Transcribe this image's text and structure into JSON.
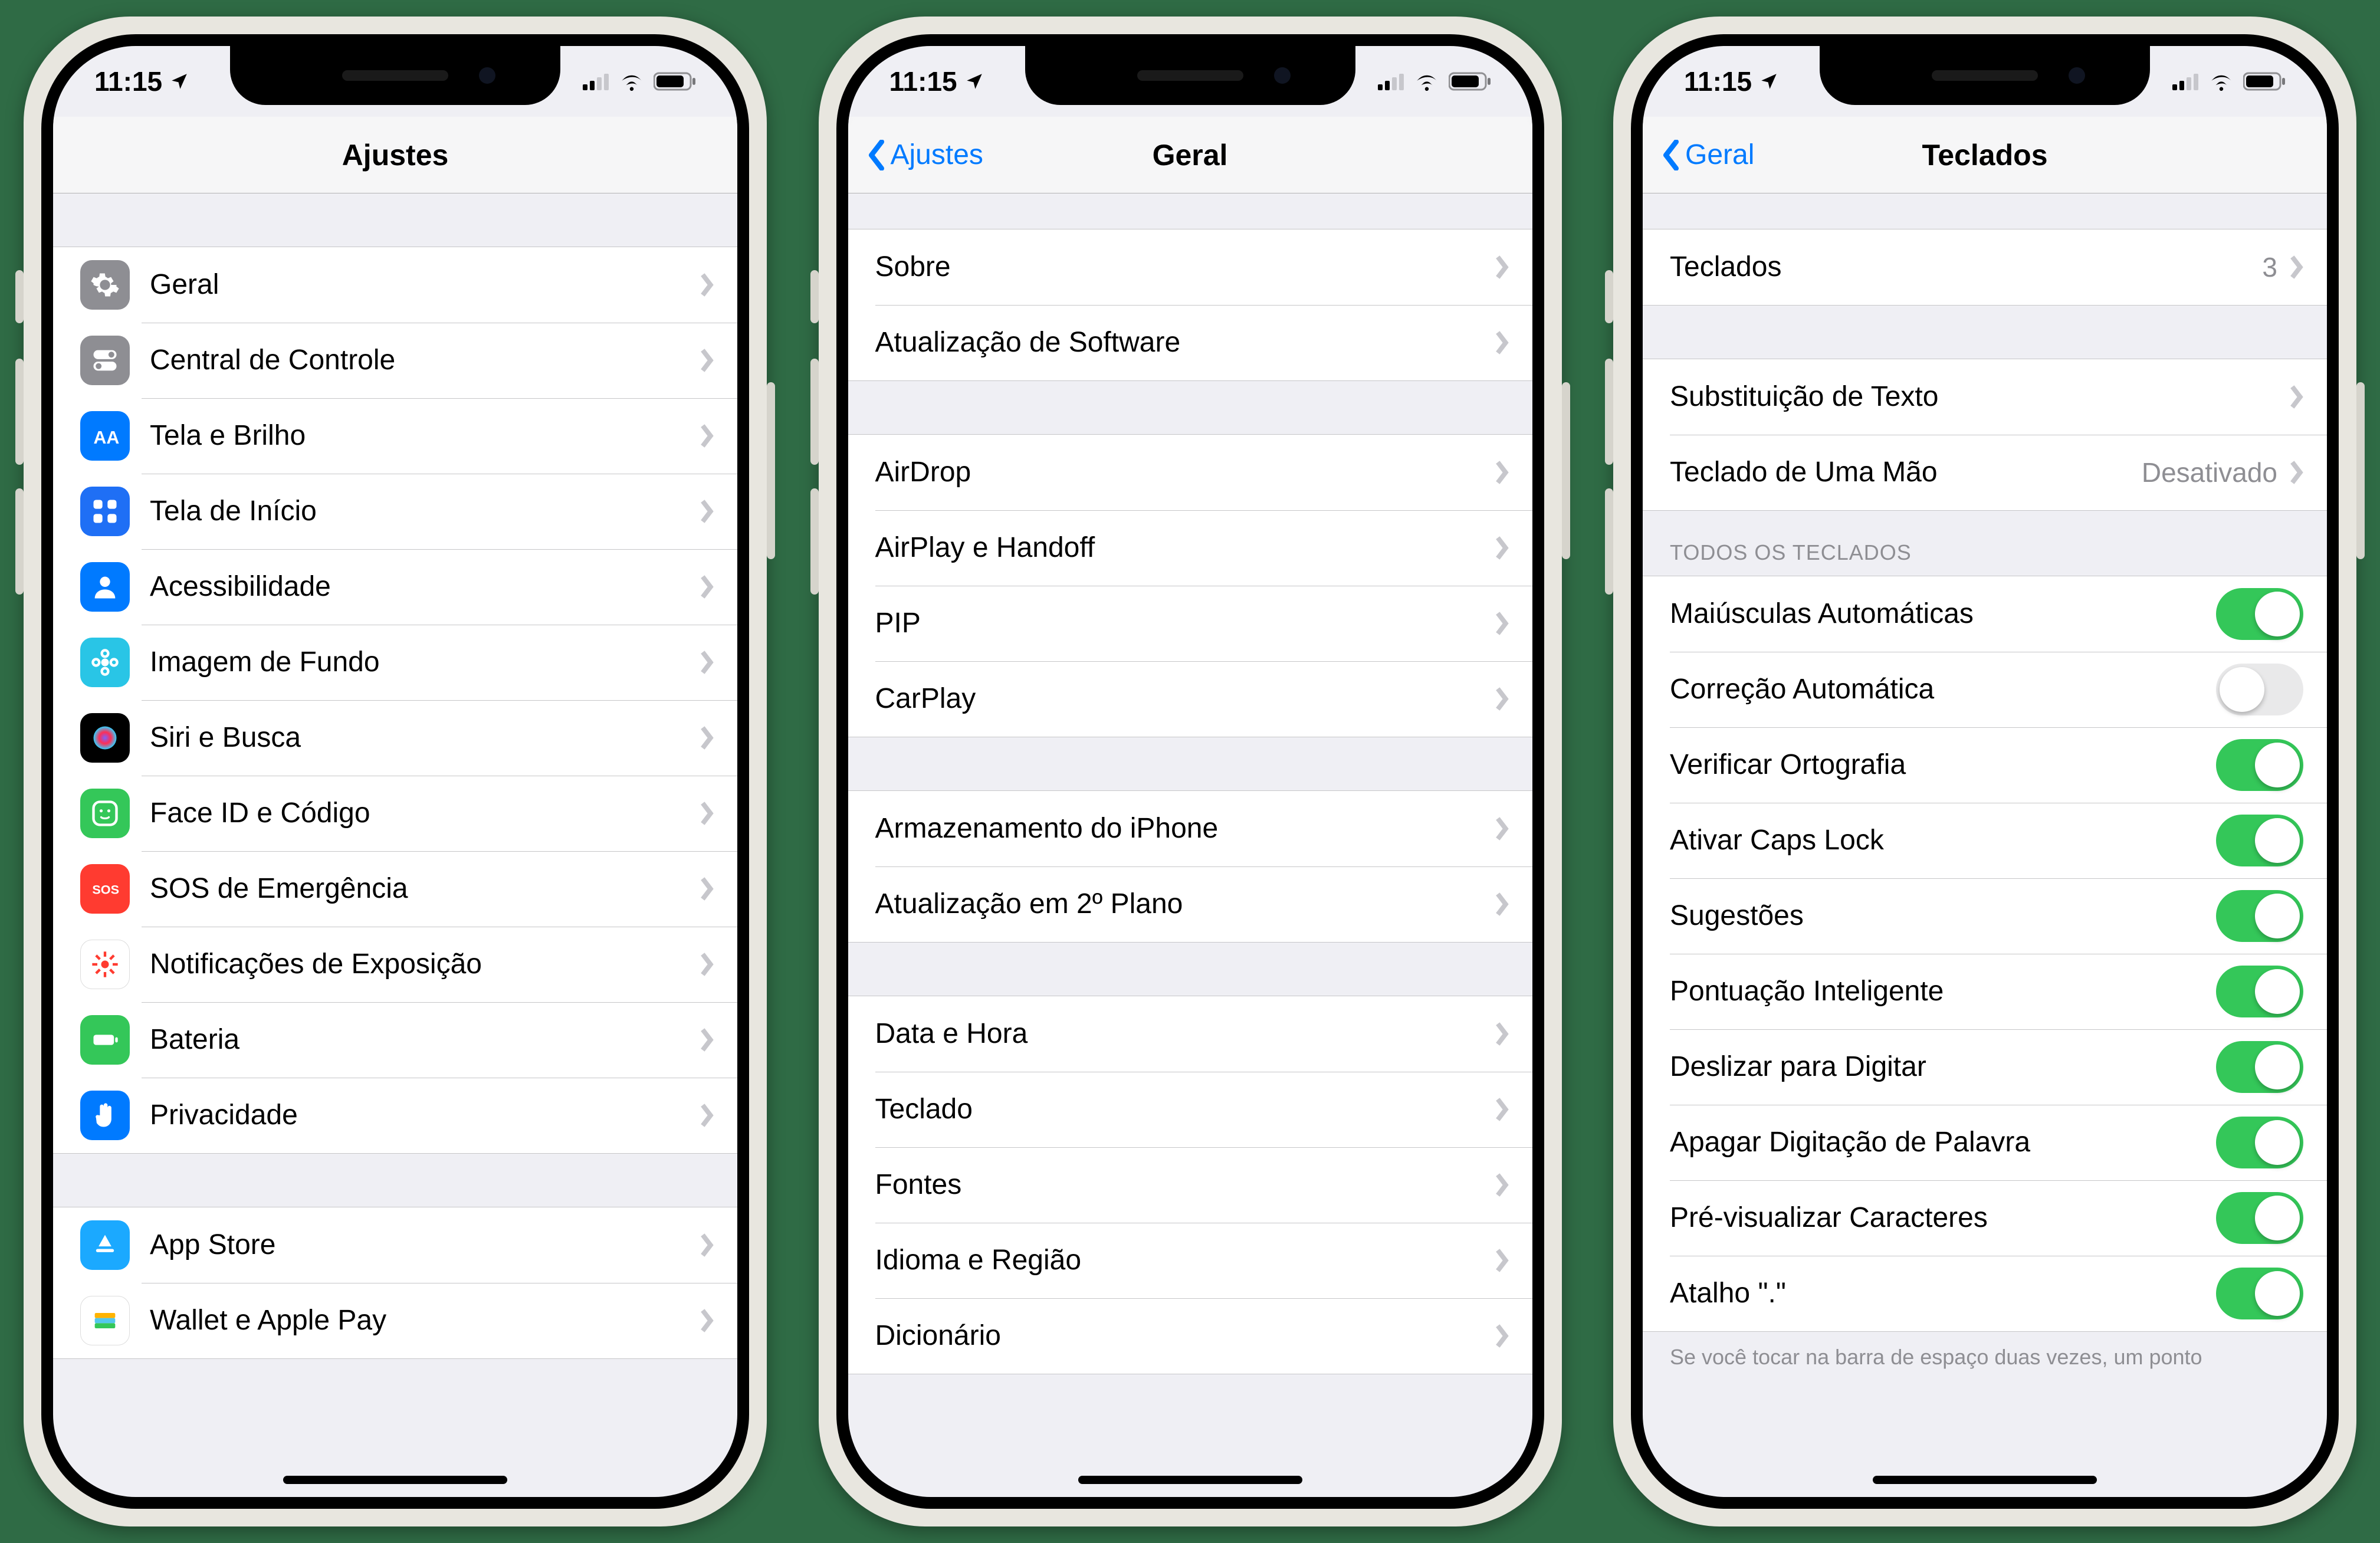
{
  "status": {
    "time": "11:15"
  },
  "phone1": {
    "nav": {
      "title": "Ajustes"
    },
    "groups": [
      [
        {
          "icon": "gear",
          "bg": "bg-gray",
          "label": "Geral"
        },
        {
          "icon": "toggles",
          "bg": "bg-gray2",
          "label": "Central de Controle"
        },
        {
          "icon": "aa",
          "bg": "bg-blue",
          "label": "Tela e Brilho"
        },
        {
          "icon": "grid",
          "bg": "bg-dblue",
          "label": "Tela de Início"
        },
        {
          "icon": "person",
          "bg": "bg-blue2",
          "label": "Acessibilidade"
        },
        {
          "icon": "flower",
          "bg": "bg-cyan",
          "label": "Imagem de Fundo"
        },
        {
          "icon": "siri",
          "bg": "bg-black",
          "label": "Siri e Busca"
        },
        {
          "icon": "face",
          "bg": "bg-green",
          "label": "Face ID e Código"
        },
        {
          "icon": "sos",
          "bg": "bg-red",
          "label": "SOS de Emergência"
        },
        {
          "icon": "burst",
          "bg": "bg-white",
          "label": "Notificações de Exposição"
        },
        {
          "icon": "battery",
          "bg": "bg-green",
          "label": "Bateria"
        },
        {
          "icon": "hand",
          "bg": "bg-hand",
          "label": "Privacidade"
        }
      ],
      [
        {
          "icon": "appstore",
          "bg": "bg-sky",
          "label": "App Store"
        },
        {
          "icon": "wallet",
          "bg": "bg-white",
          "label": "Wallet e Apple Pay"
        }
      ]
    ]
  },
  "phone2": {
    "nav": {
      "back": "Ajustes",
      "title": "Geral"
    },
    "groups": [
      [
        "Sobre",
        "Atualização de Software"
      ],
      [
        "AirDrop",
        "AirPlay e Handoff",
        "PIP",
        "CarPlay"
      ],
      [
        "Armazenamento do iPhone",
        "Atualização em 2º Plano"
      ],
      [
        "Data e Hora",
        "Teclado",
        "Fontes",
        "Idioma e Região",
        "Dicionário"
      ]
    ]
  },
  "phone3": {
    "nav": {
      "back": "Geral",
      "title": "Teclados"
    },
    "group1": [
      {
        "label": "Teclados",
        "detail": "3"
      }
    ],
    "group2": [
      {
        "label": "Substituição de Texto"
      },
      {
        "label": "Teclado de Uma Mão",
        "detail": "Desativado"
      }
    ],
    "section_header": "TODOS OS TECLADOS",
    "switches": [
      {
        "label": "Maiúsculas Automáticas",
        "on": true
      },
      {
        "label": "Correção Automática",
        "on": false
      },
      {
        "label": "Verificar Ortografia",
        "on": true
      },
      {
        "label": "Ativar Caps Lock",
        "on": true
      },
      {
        "label": "Sugestões",
        "on": true
      },
      {
        "label": "Pontuação Inteligente",
        "on": true
      },
      {
        "label": "Deslizar para Digitar",
        "on": true
      },
      {
        "label": "Apagar Digitação de Palavra",
        "on": true
      },
      {
        "label": "Pré-visualizar Caracteres",
        "on": true
      },
      {
        "label": "Atalho \".\"",
        "on": true
      }
    ],
    "footer": "Se você tocar na barra de espaço duas vezes, um ponto"
  }
}
